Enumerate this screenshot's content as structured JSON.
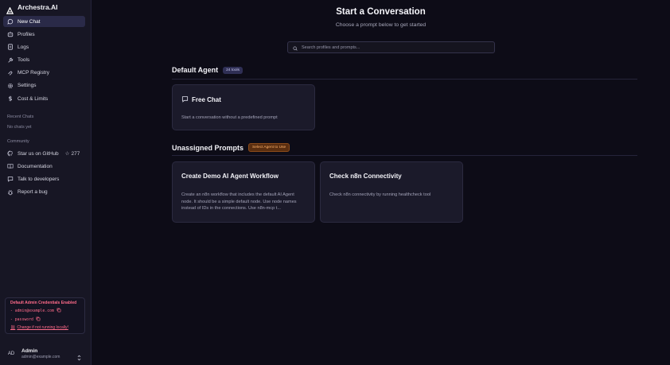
{
  "brand": {
    "name": "Archestra.AI"
  },
  "sidebar": {
    "nav": [
      {
        "label": "New Chat",
        "icon": "chat-bubble-icon",
        "active": true
      },
      {
        "label": "Profiles",
        "icon": "bot-icon"
      },
      {
        "label": "Logs",
        "icon": "logs-icon"
      },
      {
        "label": "Tools",
        "icon": "wrench-icon"
      },
      {
        "label": "MCP Registry",
        "icon": "registry-icon"
      },
      {
        "label": "Settings",
        "icon": "gear-icon"
      },
      {
        "label": "Cost & Limits",
        "icon": "dollar-icon"
      }
    ],
    "recent_chats_label": "Recent Chats",
    "no_chats_text": "No chats yet",
    "community_label": "Community",
    "community": [
      {
        "label": "Star us on GitHub",
        "icon": "github-icon",
        "stars": "277"
      },
      {
        "label": "Documentation",
        "icon": "book-icon"
      },
      {
        "label": "Talk to developers",
        "icon": "message-icon"
      },
      {
        "label": "Report a bug",
        "icon": "bug-icon"
      }
    ],
    "credentials": {
      "title": "Default Admin Credentials Enabled",
      "email_line": "- admin@example.com",
      "password_line": "- password",
      "link": "Change if not running locally!"
    },
    "user": {
      "initials": "AD",
      "name": "Admin",
      "email": "admin@example.com"
    }
  },
  "main": {
    "title": "Start a Conversation",
    "subtitle": "Choose a prompt below to get started",
    "search_placeholder": "Search profiles and prompts...",
    "default_agent": {
      "title": "Default Agent",
      "badge": "24 tools",
      "cards": [
        {
          "title": "Free Chat",
          "description": "Start a conversation without a predefined prompt"
        }
      ]
    },
    "unassigned": {
      "title": "Unassigned Prompts",
      "badge": "Select Agent to Use",
      "cards": [
        {
          "title": "Create Demo AI Agent Workflow",
          "description": "Create an n8n workflow that includes the default AI Agent node. It should be a simple default node. Use node names instead of IDs in the connections. Use n8n-mcp t..."
        },
        {
          "title": "Check n8n Connectivity",
          "description": "Check n8n connectivity by running healthcheck tool"
        }
      ]
    }
  }
}
